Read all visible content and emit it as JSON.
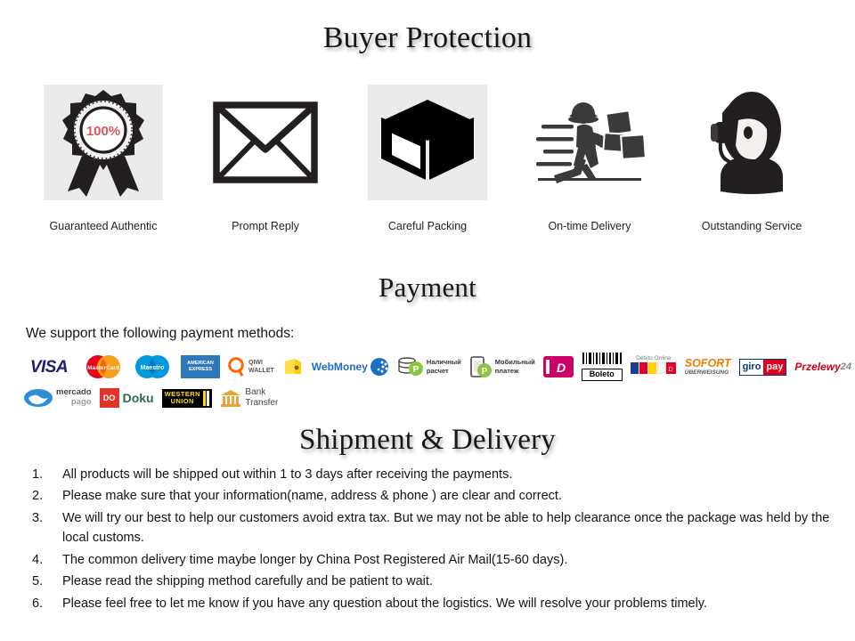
{
  "sections": {
    "buyer_protection_title": "Buyer Protection",
    "payment_title": "Payment",
    "shipment_title": "Shipment & Delivery"
  },
  "features": [
    {
      "label": "Guaranteed Authentic",
      "icon": "award-rosette-icon",
      "badge_text": "100%",
      "boxed": true
    },
    {
      "label": "Prompt  Reply",
      "icon": "envelope-icon",
      "boxed": false
    },
    {
      "label": "Careful Packing",
      "icon": "open-box-icon",
      "boxed": true
    },
    {
      "label": "On-time Delivery",
      "icon": "running-courier-icon",
      "boxed": false
    },
    {
      "label": "Outstanding Service",
      "icon": "headset-agent-icon",
      "boxed": false
    }
  ],
  "payment": {
    "intro": "We support the following payment methods:",
    "methods_row1": [
      {
        "name": "VISA",
        "icon": "visa-logo"
      },
      {
        "name": "MasterCard",
        "icon": "mastercard-logo"
      },
      {
        "name": "Maestro",
        "icon": "maestro-logo"
      },
      {
        "name": "American Express",
        "icon": "amex-logo"
      },
      {
        "name": "QIWI WALLET",
        "icon": "qiwi-wallet-logo"
      },
      {
        "name": "Yandex Money",
        "icon": "yellow-wallet-logo"
      },
      {
        "name": "WebMoney",
        "icon": "webmoney-logo"
      },
      {
        "name": "Наличный расчет",
        "icon": "cash-payment-logo"
      },
      {
        "name": "Мобильный платеж",
        "icon": "mobile-payment-logo"
      },
      {
        "name": "iDEAL",
        "icon": "ideal-logo"
      },
      {
        "name": "Boleto",
        "icon": "boleto-logo"
      },
      {
        "name": "Débito Online",
        "icon": "debito-online-logo"
      },
      {
        "name": "SOFORT ÜBERWEISUNG",
        "icon": "sofort-logo"
      },
      {
        "name": "giropay",
        "icon": "giropay-logo"
      },
      {
        "name": "Przelewy24",
        "icon": "przelewy24-logo"
      }
    ],
    "methods_row2": [
      {
        "name": "mercado pago",
        "icon": "mercadopago-logo"
      },
      {
        "name": "Doku",
        "icon": "doku-logo"
      },
      {
        "name": "WESTERN UNION",
        "icon": "western-union-logo"
      },
      {
        "name": "Bank Transfer",
        "icon": "bank-transfer-logo"
      }
    ],
    "labels": {
      "visa": "VISA",
      "mastercard": "MasterCard",
      "maestro": "Maestro",
      "amex_line1": "AMERICAN",
      "amex_line2": "EXPRESS",
      "qiwi_line1": "QIWI",
      "qiwi_line2": "WALLET",
      "webmoney": "WebMoney",
      "cash_line1": "Наличный",
      "cash_line2": "расчет",
      "mobile_line1": "Мобильный",
      "mobile_line2": "платеж",
      "ideal": "iD",
      "boleto": "Boleto",
      "debito": "Débito Online",
      "sofort_line1": "SOFORT",
      "sofort_line2": "ÜBERWEISUNG",
      "giro": "giro",
      "giropay_pay": "pay",
      "przelewy": "Przelewy",
      "przelewy_num": "24",
      "mercado_line1": "mercado",
      "mercado_line2": "pago",
      "doku_mark": "DO",
      "doku": "Doku",
      "wu_line1": "WESTERN",
      "wu_line2": "UNION",
      "bank_line1": "Bank",
      "bank_line2": "Transfer"
    }
  },
  "shipment_items": [
    {
      "num": "1.",
      "text": "All products will be shipped out within 1 to 3 days after receiving the payments."
    },
    {
      "num": "2.",
      "text": "Please make sure that your information(name, address & phone ) are clear and correct."
    },
    {
      "num": "3.",
      "text": "We will try our best to help our customers avoid extra tax. But we may not be able to help clearance once the package was held by the local customs."
    },
    {
      "num": "4.",
      "text": "The common delivery time maybe longer by China Post Registered Air Mail(15-60 days)."
    },
    {
      "num": "5.",
      "text": "Please read the shipping method carefully and be patient to wait."
    },
    {
      "num": "6.",
      "text": "Please feel free to let me know if you have any question about the logistics. We will resolve your problems timely."
    }
  ],
  "colors": {
    "ink": "#17171a",
    "badge_red": "#d4585f",
    "icon_dark": "#231f20",
    "feature_box_bg": "#ebebeb",
    "visa_blue": "#1a1f71",
    "mc_red": "#eb001b",
    "mc_yellow": "#f79e1b",
    "maestro_blue": "#0099df",
    "amex_blue": "#2e77bb",
    "qiwi_orange": "#f60",
    "webmoney_blue": "#1a6fc4",
    "green": "#8cc63f",
    "ideal_pink": "#cc0066",
    "sofort_orange": "#ef7d00",
    "giro_blue": "#003a7d",
    "giro_red": "#e4001b",
    "wu_yellow": "#ffdd00",
    "mercado_blue": "#2d8fd5"
  }
}
